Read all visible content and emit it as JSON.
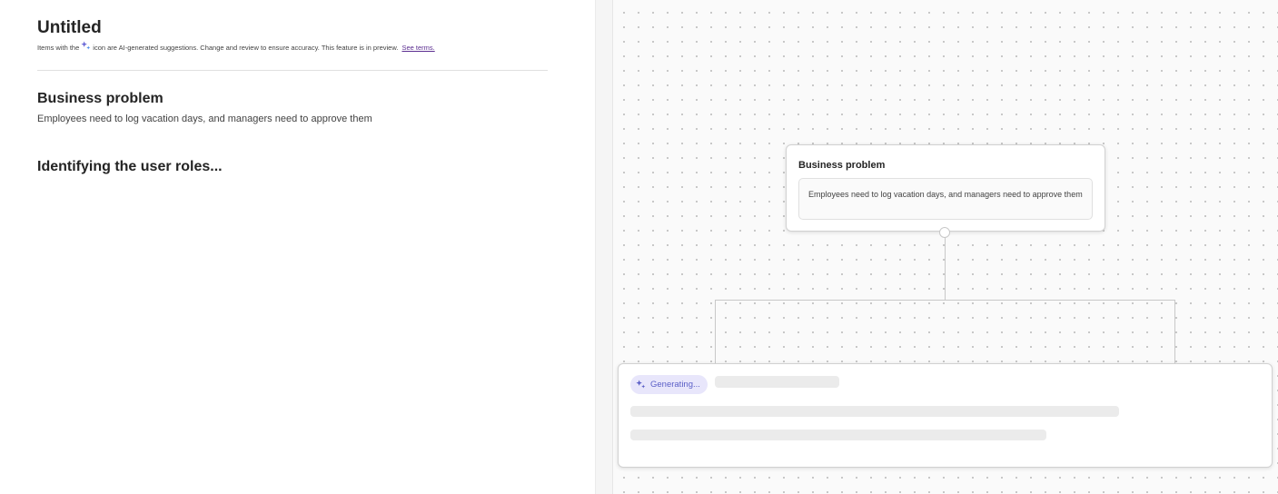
{
  "document": {
    "title": "Untitled",
    "notice_prefix": "Items with the",
    "notice_suffix": "icon are AI-generated suggestions. Change and review to ensure accuracy. This feature is in preview.",
    "notice_link": "See terms.",
    "sparkle_icon": "sparkle-icon",
    "section_heading": "Business problem",
    "section_body": "Employees need to log vacation days, and managers need to approve them",
    "loading_heading": "Identifying the user roles..."
  },
  "canvas": {
    "node": {
      "title": "Business problem",
      "description": "Employees need to log vacation days, and managers need to approve them"
    },
    "generating_label": "Generating...",
    "accent_color": "#5b5fc7"
  }
}
